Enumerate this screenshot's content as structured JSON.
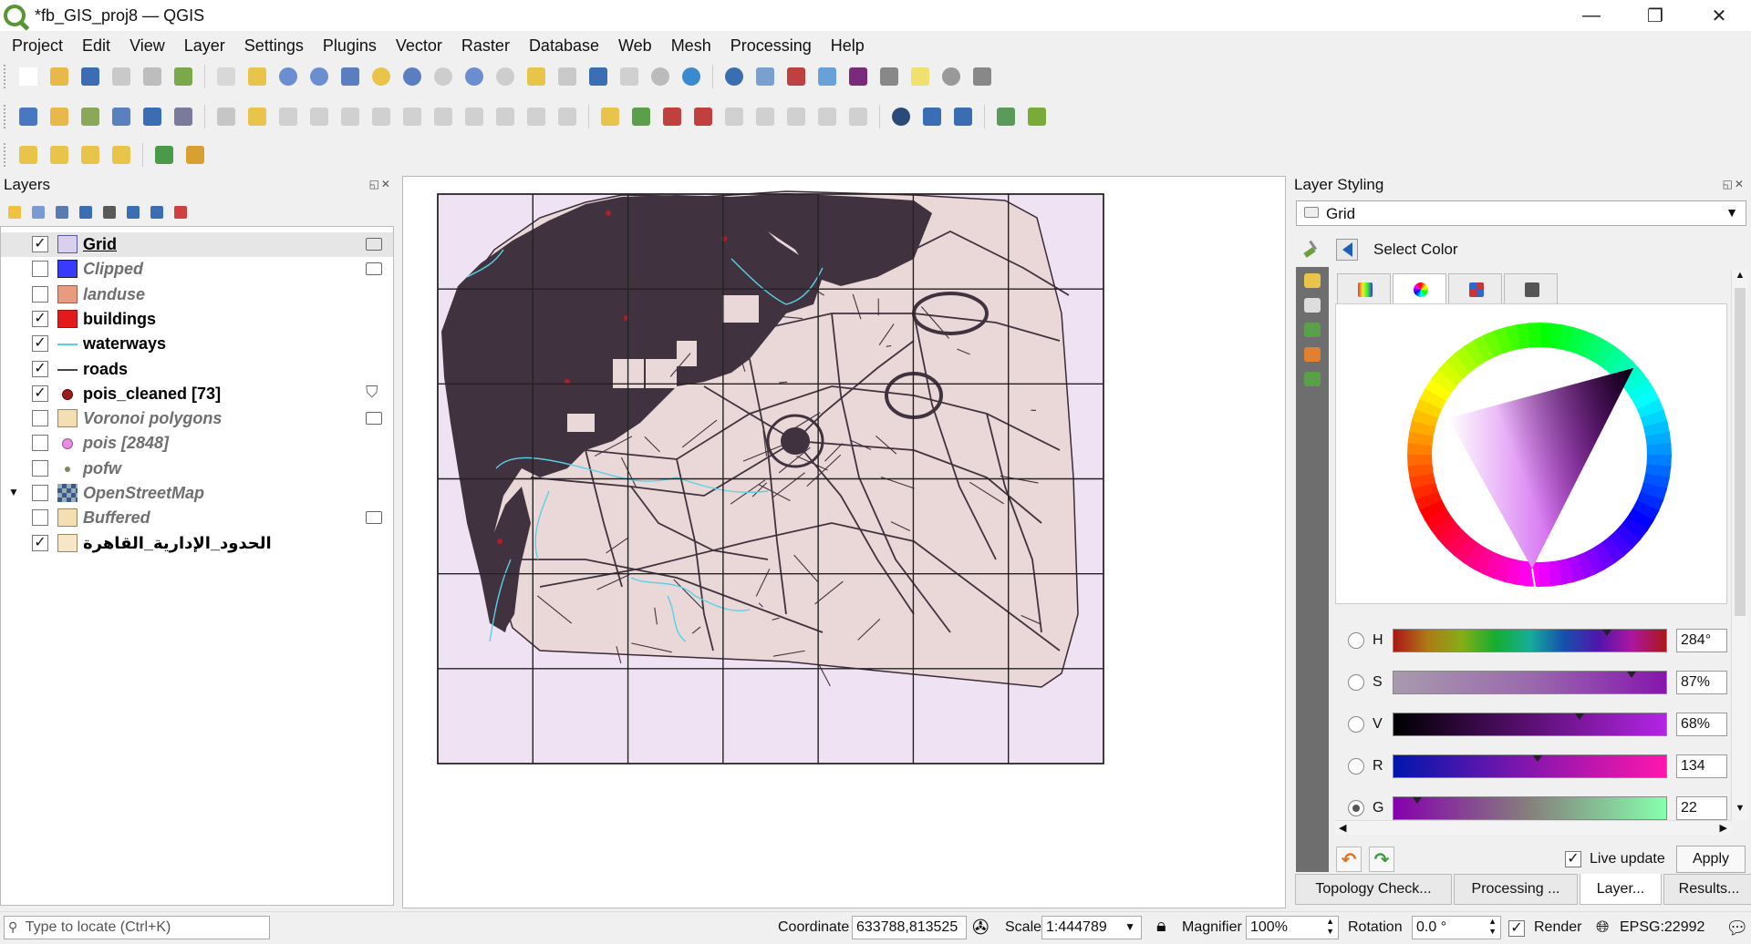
{
  "window": {
    "title": "*fb_GIS_proj8 — QGIS",
    "controls": {
      "minimize": "—",
      "restore": "❐",
      "close": "✕"
    }
  },
  "menu": [
    "Project",
    "Edit",
    "View",
    "Layer",
    "Settings",
    "Plugins",
    "Vector",
    "Raster",
    "Database",
    "Web",
    "Mesh",
    "Processing",
    "Help"
  ],
  "layers_panel": {
    "title": "Layers",
    "items": [
      {
        "name": "Grid",
        "checked": true,
        "style": "bold-underline",
        "symbol": "fill",
        "color": "#d9d0f0",
        "stroke": "#5b5b9a",
        "tag": "render"
      },
      {
        "name": "Clipped",
        "checked": false,
        "style": "italic",
        "symbol": "fill",
        "color": "#3a3aff",
        "stroke": "#222",
        "tag": "render"
      },
      {
        "name": "landuse",
        "checked": false,
        "style": "italic",
        "symbol": "fill",
        "color": "#e89b80",
        "stroke": "#a05a44",
        "tag": ""
      },
      {
        "name": "buildings",
        "checked": true,
        "style": "bold",
        "symbol": "fill",
        "color": "#e31a1c",
        "stroke": "#a01010",
        "tag": ""
      },
      {
        "name": "waterways",
        "checked": true,
        "style": "bold",
        "symbol": "line",
        "color": "#5ad0e6",
        "stroke": "#5ad0e6",
        "tag": ""
      },
      {
        "name": "roads",
        "checked": true,
        "style": "bold",
        "symbol": "line",
        "color": "#444",
        "stroke": "#444",
        "tag": ""
      },
      {
        "name": "pois_cleaned [73]",
        "checked": true,
        "style": "bold",
        "symbol": "point",
        "color": "#9b1c1c",
        "stroke": "#600",
        "tag": "filter"
      },
      {
        "name": "Voronoi polygons",
        "checked": false,
        "style": "italic",
        "symbol": "fill",
        "color": "#f3dfb3",
        "stroke": "#9a8660",
        "tag": "render"
      },
      {
        "name": "pois [2848]",
        "checked": false,
        "style": "italic",
        "symbol": "point",
        "color": "#e58fe0",
        "stroke": "#a04fa0",
        "tag": ""
      },
      {
        "name": "pofw",
        "checked": false,
        "style": "italic",
        "symbol": "smallpoint",
        "color": "#7a8a5a",
        "stroke": "#556",
        "tag": ""
      },
      {
        "name": "OpenStreetMap",
        "checked": false,
        "style": "italic",
        "symbol": "raster",
        "color": "#3a5a8a",
        "stroke": "#234",
        "tag": "",
        "expander": true
      },
      {
        "name": "Buffered",
        "checked": false,
        "style": "italic",
        "symbol": "fill",
        "color": "#f3dfb3",
        "stroke": "#9a8660",
        "tag": "render"
      },
      {
        "name": "الحدود_الإدارية_القاهرة",
        "checked": true,
        "style": "normal",
        "symbol": "fill",
        "color": "#f6e7c9",
        "stroke": "#9a8660",
        "tag": ""
      }
    ]
  },
  "layer_styling": {
    "title": "Layer Styling",
    "layer_combo": "Grid",
    "breadcrumb": "Select Color",
    "color_tabs": [
      "ramp-icon",
      "wheel-icon",
      "swatch-icon",
      "picker-icon"
    ],
    "channels": [
      {
        "label": "H",
        "value": "284°",
        "pos": 0.78
      },
      {
        "label": "S",
        "value": "87%",
        "pos": 0.87
      },
      {
        "label": "V",
        "value": "68%",
        "pos": 0.68
      },
      {
        "label": "R",
        "value": "134",
        "pos": 0.525
      },
      {
        "label": "G",
        "value": "22",
        "pos": 0.086
      }
    ],
    "live_update_label": "Live update",
    "live_update_checked": true,
    "apply_label": "Apply",
    "bottom_tabs": [
      "Topology Check...",
      "Processing ...",
      "Layer...",
      "Results..."
    ]
  },
  "statusbar": {
    "locator_placeholder": "Type to locate (Ctrl+K)",
    "coordinate_label": "Coordinate",
    "coordinate_value": "633788,813525",
    "scale_label": "Scale",
    "scale_value": "1:444789",
    "magnifier_label": "Magnifier",
    "magnifier_value": "100%",
    "rotation_label": "Rotation",
    "rotation_value": "0.0 °",
    "render_label": "Render",
    "crs_label": "EPSG:22992"
  },
  "colors": {
    "grid_fill": "#efe3f3",
    "boundary_fill": "#ead8d8",
    "urban": "#41323f",
    "waterway": "#5ad0e6",
    "selected_color": "#8616ad"
  }
}
